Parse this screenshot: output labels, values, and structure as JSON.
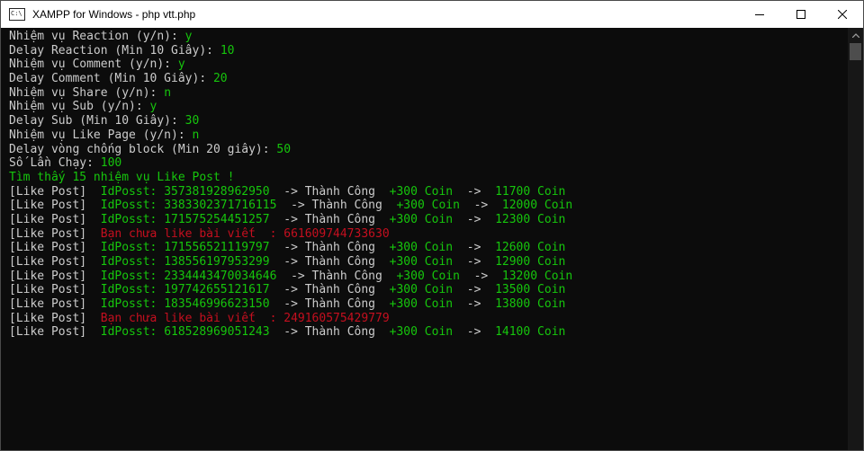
{
  "window": {
    "title": "XAMPP for Windows - php  vtt.php"
  },
  "config_lines": [
    {
      "label": "Nhiệm vụ Reaction (y/n): ",
      "value": "y"
    },
    {
      "label": "Delay Reaction (Min 10 Giây): ",
      "value": "10"
    },
    {
      "label": "Nhiệm vụ Comment (y/n): ",
      "value": "y"
    },
    {
      "label": "Delay Comment (Min 10 Giây): ",
      "value": "20"
    },
    {
      "label": "Nhiệm vụ Share (y/n): ",
      "value": "n"
    },
    {
      "label": "Nhiệm vụ Sub (y/n): ",
      "value": "y"
    },
    {
      "label": "Delay Sub (Min 10 Giây): ",
      "value": "30"
    },
    {
      "label": "Nhiệm vụ Like Page (y/n): ",
      "value": "n"
    },
    {
      "label": "Delay vòng chống block (Min 20 giây): ",
      "value": "50"
    },
    {
      "label": "Số Lần Chạy: ",
      "value": "100"
    }
  ],
  "found_message": "Tìm thấy 15 nhiệm vụ Like Post !",
  "log_lines": [
    {
      "type": "ok",
      "tag": "[Like Post]",
      "id_text": "IdPosst: 357381928962950",
      "arrow1": "-> Thành Công",
      "coin": "+300 Coin",
      "arrow2": "->",
      "total": "11700 Coin"
    },
    {
      "type": "ok",
      "tag": "[Like Post]",
      "id_text": "IdPosst: 3383302371716115",
      "arrow1": "-> Thành Công",
      "coin": "+300 Coin",
      "arrow2": "->",
      "total": "12000 Coin"
    },
    {
      "type": "ok",
      "tag": "[Like Post]",
      "id_text": "IdPosst: 171575254451257",
      "arrow1": "-> Thành Công",
      "coin": "+300 Coin",
      "arrow2": "->",
      "total": "12300 Coin"
    },
    {
      "type": "err",
      "tag": "[Like Post]",
      "message": "Bạn chưa like bài viết  : 661609744733630"
    },
    {
      "type": "ok",
      "tag": "[Like Post]",
      "id_text": "IdPosst: 171556521119797",
      "arrow1": "-> Thành Công",
      "coin": "+300 Coin",
      "arrow2": "->",
      "total": "12600 Coin"
    },
    {
      "type": "ok",
      "tag": "[Like Post]",
      "id_text": "IdPosst: 138556197953299",
      "arrow1": "-> Thành Công",
      "coin": "+300 Coin",
      "arrow2": "->",
      "total": "12900 Coin"
    },
    {
      "type": "ok",
      "tag": "[Like Post]",
      "id_text": "IdPosst: 2334443470034646",
      "arrow1": "-> Thành Công",
      "coin": "+300 Coin",
      "arrow2": "->",
      "total": "13200 Coin"
    },
    {
      "type": "ok",
      "tag": "[Like Post]",
      "id_text": "IdPosst: 197742655121617",
      "arrow1": "-> Thành Công",
      "coin": "+300 Coin",
      "arrow2": "->",
      "total": "13500 Coin"
    },
    {
      "type": "ok",
      "tag": "[Like Post]",
      "id_text": "IdPosst: 183546996623150",
      "arrow1": "-> Thành Công",
      "coin": "+300 Coin",
      "arrow2": "->",
      "total": "13800 Coin"
    },
    {
      "type": "err",
      "tag": "[Like Post]",
      "message": "Bạn chưa like bài viết  : 249160575429779"
    },
    {
      "type": "ok",
      "tag": "[Like Post]",
      "id_text": "IdPosst: 618528969051243",
      "arrow1": "-> Thành Công",
      "coin": "+300 Coin",
      "arrow2": "->",
      "total": "14100 Coin"
    }
  ],
  "colors": {
    "success": "#16c60c",
    "error": "#c50f1f",
    "text": "#cccccc",
    "background": "#0c0c0c"
  },
  "icons": {
    "app": "console-icon",
    "minimize": "minimize-icon",
    "maximize": "maximize-icon",
    "close": "close-icon"
  }
}
